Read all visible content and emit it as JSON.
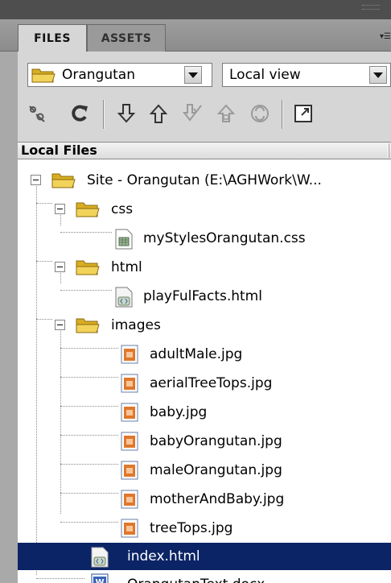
{
  "tabs": [
    {
      "label": "FILES",
      "active": true
    },
    {
      "label": "ASSETS",
      "active": false
    }
  ],
  "site_select": {
    "value": "Orangutan"
  },
  "view_select": {
    "value": "Local view"
  },
  "toolbar": {
    "icons": [
      "connect-icon",
      "refresh-icon",
      "get-files-icon",
      "put-files-icon",
      "checkout-icon",
      "checkin-icon",
      "synchronize-icon",
      "expand-icon"
    ]
  },
  "files_header": {
    "label": "Local Files"
  },
  "tree": {
    "root": "Site - Orangutan (E:\\AGHWork\\W...",
    "css_folder": "css",
    "css_file": "myStylesOrangutan.css",
    "html_folder": "html",
    "html_file": "playFulFacts.html",
    "images_folder": "images",
    "images": [
      "adultMale.jpg",
      "aerialTreeTops.jpg",
      "baby.jpg",
      "babyOrangutan.jpg",
      "maleOrangutan.jpg",
      "motherAndBaby.jpg",
      "treeTops.jpg"
    ],
    "index_file": "index.html",
    "doc_file": "OrangutanText.docx"
  },
  "colors": {
    "selection": "#0b2466",
    "folder": "#e9c23a",
    "panel": "#d6d6d6"
  }
}
